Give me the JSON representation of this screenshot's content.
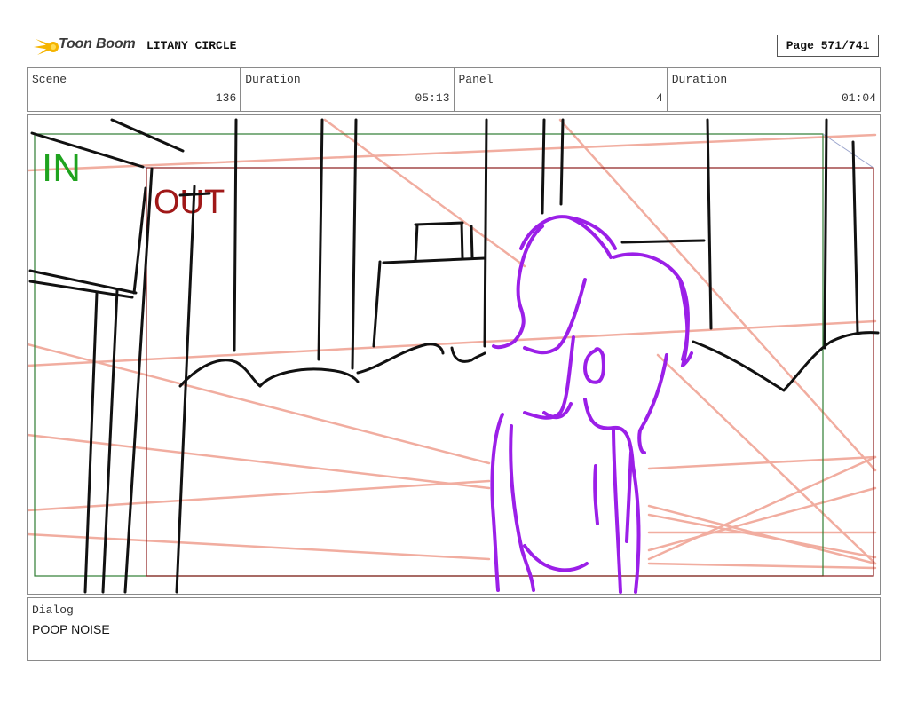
{
  "header": {
    "logo_text": "Toon Boom",
    "project_title": "LITANY CIRCLE",
    "page_label": "Page 571/741"
  },
  "info": {
    "scene_label": "Scene",
    "scene_value": "136",
    "duration_label": "Duration",
    "duration_value": "05:13",
    "panel_label": "Panel",
    "panel_value": "4",
    "panel_duration_label": "Duration",
    "panel_duration_value": "01:04"
  },
  "panel": {
    "in_label": "IN",
    "out_label": "OUT",
    "colors": {
      "in_frame": "#2e7d32",
      "out_frame": "#8b1a1a",
      "character": "#9b1fe8",
      "perspective_lines": "#f0a596",
      "sketch": "#111111"
    }
  },
  "dialog": {
    "label": "Dialog",
    "text": "POOP NOISE"
  }
}
